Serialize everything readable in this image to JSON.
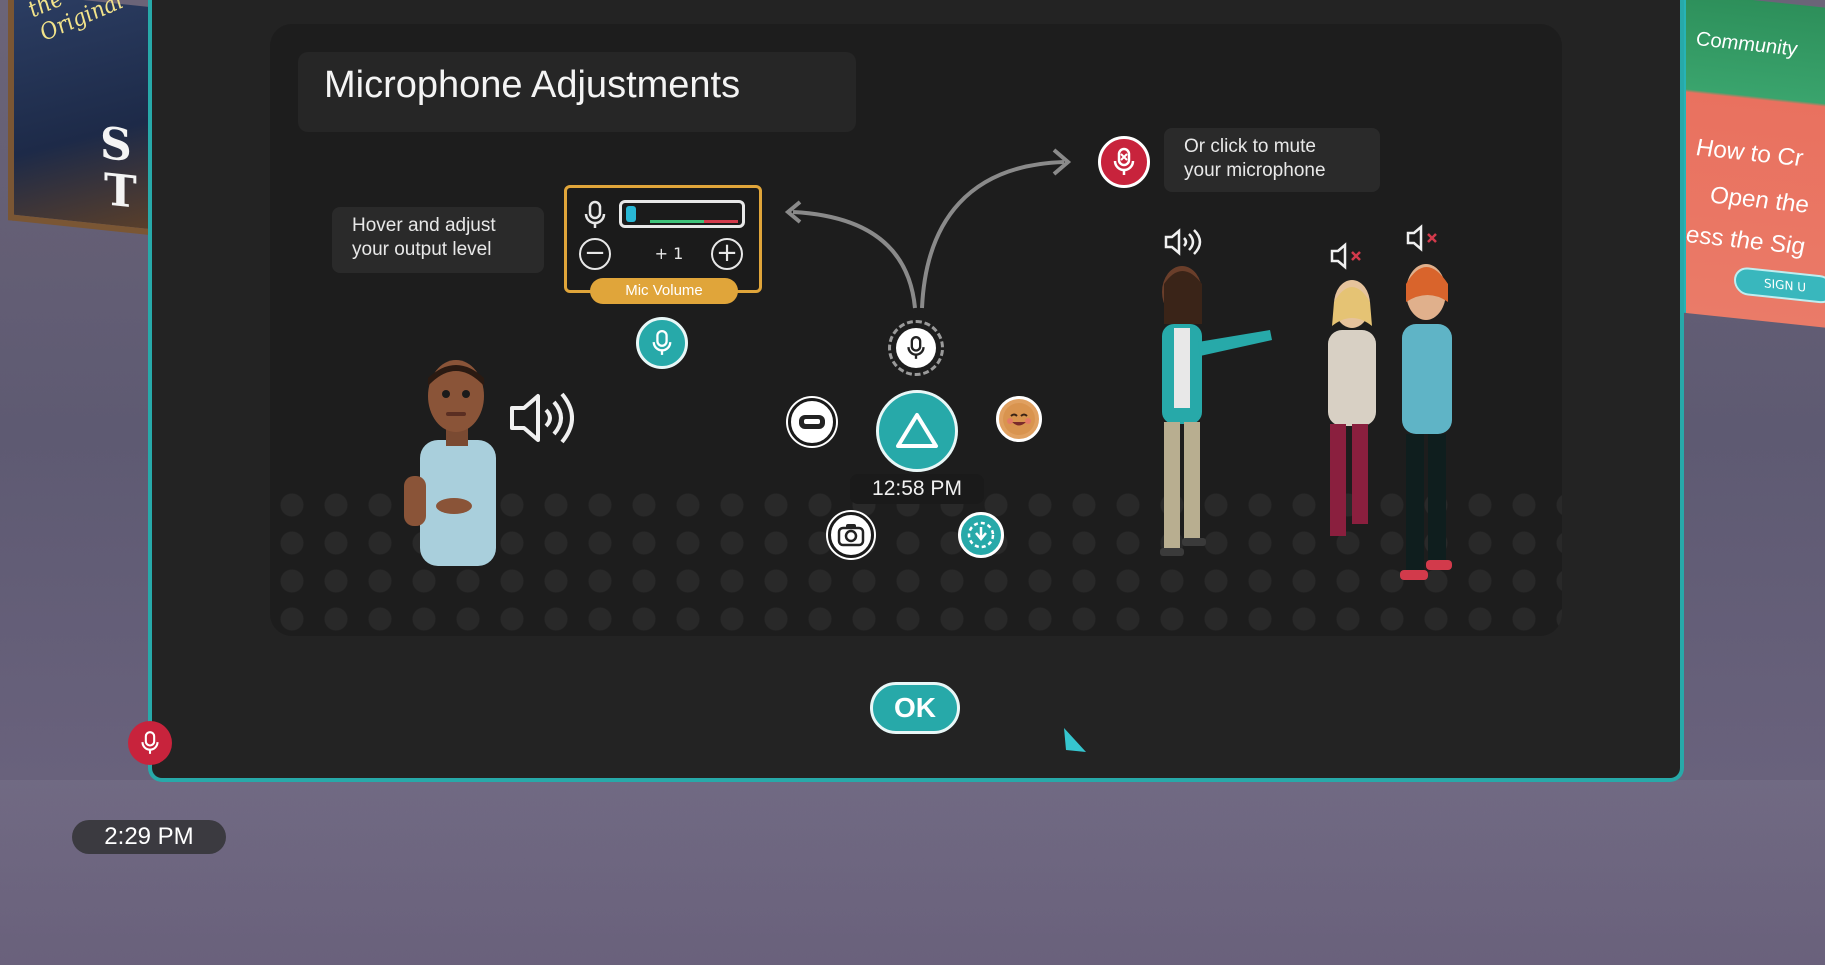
{
  "background": {
    "left_sign_script": "the Original",
    "left_sign_letters": [
      "S",
      "T"
    ],
    "right_panel_header": "Community",
    "right_panel_lines": [
      "How to Cr",
      "Open the",
      "ess the Sig"
    ],
    "right_panel_button": "SIGN U"
  },
  "dialog": {
    "title": "Microphone Adjustments",
    "hover_callout": {
      "line1": "Hover and adjust",
      "line2": "your output level"
    },
    "mute_callout": {
      "line1": "Or click to mute",
      "line2": "your microphone"
    },
    "mic_volume": {
      "minus": "−",
      "plus": "+",
      "level": "+ 1",
      "label": "Mic Volume"
    },
    "menu_time": "12:58 PM",
    "ok_label": "OK"
  },
  "hud": {
    "clock": "2:29 PM"
  },
  "colors": {
    "teal": "#27a9a9",
    "mic_amber": "#e0a53a",
    "mute_red": "#c8233c",
    "panel": "#232323"
  }
}
